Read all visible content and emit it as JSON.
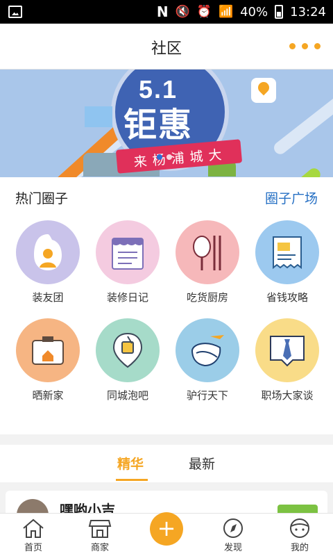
{
  "status_bar": {
    "battery": "40%",
    "time": "13:24"
  },
  "header": {
    "title": "社区"
  },
  "banner": {
    "title_line1": "5.1",
    "title_line2": "钜惠",
    "ribbon": "来杨浦城大"
  },
  "hot_circles": {
    "heading": "热门圈子",
    "link": "圈子广场",
    "items": [
      {
        "label": "装友团",
        "icon": "person-icon",
        "color": "#c9c3ea"
      },
      {
        "label": "装修日记",
        "icon": "diary-icon",
        "color": "#f4cbe0"
      },
      {
        "label": "吃货厨房",
        "icon": "food-icon",
        "color": "#f6b8ba"
      },
      {
        "label": "省钱攻略",
        "icon": "receipt-icon",
        "color": "#9cc9ef"
      },
      {
        "label": "晒新家",
        "icon": "camera-icon",
        "color": "#f6b583"
      },
      {
        "label": "同城泡吧",
        "icon": "drink-icon",
        "color": "#a6dbc9"
      },
      {
        "label": "驴行天下",
        "icon": "travel-icon",
        "color": "#9bcde8"
      },
      {
        "label": "职场大家谈",
        "icon": "tie-icon",
        "color": "#f9dc88"
      }
    ]
  },
  "tabs": [
    {
      "label": "精华",
      "active": true
    },
    {
      "label": "最新",
      "active": false
    }
  ],
  "post": {
    "author": "嘿哟小吉"
  },
  "bottom_nav": [
    {
      "label": "首页",
      "icon": "home-icon"
    },
    {
      "label": "商家",
      "icon": "shop-icon"
    },
    {
      "label": "",
      "icon": "add-icon"
    },
    {
      "label": "发现",
      "icon": "compass-icon"
    },
    {
      "label": "我的",
      "icon": "profile-icon"
    }
  ]
}
